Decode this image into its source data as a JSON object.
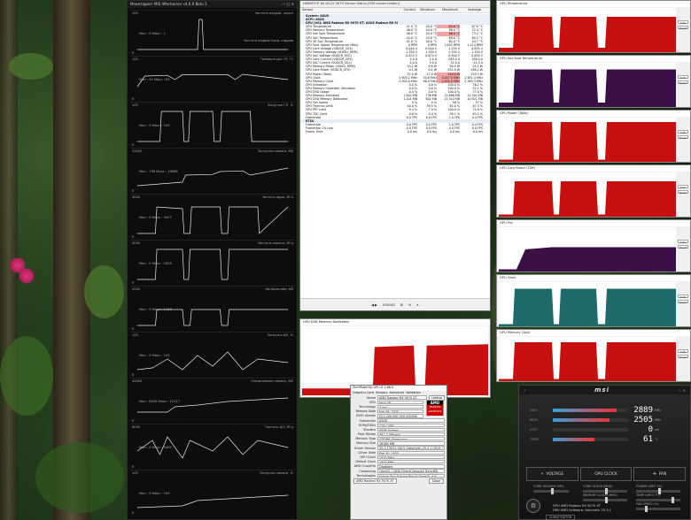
{
  "afterburner": {
    "title": "Мониторинг MSI Afterburner v4.6.6 Beta 5",
    "panels": [
      {
        "top": "Частота кадров, средн",
        "right": "Частота кадров Сред. кадров",
        "max": "100",
        "min": "0",
        "left": "Мин : 0   Макс : 1"
      },
      {
        "top": "Температура ГП, °С",
        "max": "100",
        "min": "0",
        "left": "Мин : 41   Макс : 83"
      },
      {
        "top": "Загрузка ГП, %",
        "max": "100",
        "min": "0",
        "left": "Мин : 0   Макс : 100"
      },
      {
        "top": "Загрузка памяти, МБ",
        "max": "32000",
        "min": "0",
        "left": "Мин : 736   Макс : 15866"
      },
      {
        "top": "Частота ядра, МГц",
        "max": "3000",
        "min": "0",
        "left": "Мин : 0   Макс : 3007"
      },
      {
        "top": "Частота памяти, МГц",
        "max": "3000",
        "min": "0",
        "left": "Мин : 0   Макс : 2505"
      },
      {
        "top": "Напряжение, мВ",
        "max": "2000",
        "min": "0",
        "left": "Мин : 0   Макс : 1155"
      },
      {
        "top": "Загрузка ЦП, %",
        "max": "100",
        "min": "0",
        "left": "Мин : 0   Макс : 100"
      },
      {
        "top": "Оперативная память, МБ",
        "max": "32000",
        "min": "0",
        "left": "Мин : 8416   Макс : 15117"
      },
      {
        "top": "Частота ЦП, МГц",
        "max": "6000",
        "min": "0",
        "left": "Мин : 0   Макс : 5400"
      },
      {
        "top": "Загрузка памяти, %",
        "max": "100",
        "min": "0",
        "left": "Мин : 0   Макс : 100"
      }
    ]
  },
  "hwinfo": {
    "title": "HWiNFO® 64 v8.22-5670 Sensor Status [556 values hidden]",
    "columns": [
      "Sensor",
      "Current",
      "Minimum",
      "Maximum",
      "Average"
    ],
    "rows": [
      {
        "s": 1,
        "n": "System: ASUS"
      },
      {
        "s": 1,
        "n": "ACPI: ASUS"
      },
      {
        "s": 1,
        "n": "GPU [#0]: AMD Radeon RX 9070 XT: ASUS Radeon RX 9070 XT"
      },
      {
        "n": "GPU Temperature",
        "c": "41.0 °C",
        "mi": "40.0 °C",
        "ma": "83.0 °C",
        "a": "67.0 °C",
        "h": 1
      },
      {
        "n": "GPU Memory Temperature",
        "c": "46.0 °C",
        "mi": "44.0 °C",
        "ma": "88.0 °C",
        "a": "72.4 °C"
      },
      {
        "n": "GPU Hot Spot Temperature",
        "c": "46.0 °C",
        "mi": "45.0 °C",
        "ma": "88.0 °C",
        "a": "73.2 °C",
        "h": 1
      },
      {
        "n": "GPU SoC Temperature",
        "c": "44.0 °C",
        "mi": "43.0 °C",
        "ma": "69.0 °C",
        "a": "60.2 °C"
      },
      {
        "n": "GPU VR SoC Temperature",
        "c": "41.0 °C",
        "mi": "40.0 °C",
        "ma": "62.0 °C",
        "a": "54.7 °C"
      },
      {
        "n": "GPU Fan1 Speed Temperature (Max)",
        "c": "0 RPM",
        "mi": "0 RPM",
        "ma": "1,852 RPM",
        "a": "1,214 RPM"
      },
      {
        "n": "GPU Core Voltage (VDDCR_GFX)",
        "c": "0.040 V",
        "mi": "0.040 V",
        "ma": "1.155 V",
        "a": "0.835 V"
      },
      {
        "n": "GPU Memory Voltage (VDDIO_MEM)",
        "c": "1.350 V",
        "mi": "1.350 V",
        "ma": "1.350 V",
        "a": "1.350 V"
      },
      {
        "n": "GPU SoC Voltage (VDDCR_SOC)",
        "c": "0.674 V",
        "mi": "0.674 V",
        "ma": "0.900 V",
        "a": "0.850 V"
      },
      {
        "n": "GPU Core Current (VDDCR_GFX)",
        "c": "2.0 A",
        "mi": "1.0 A",
        "ma": "283.0 A",
        "a": "198.4 A"
      },
      {
        "n": "GPU SoC Current (VDDCR_SOC)",
        "c": "4.0 A",
        "mi": "3.0 A",
        "ma": "31.0 A",
        "a": "24.3 A"
      },
      {
        "n": "GPU Memory Power (VDDCI_MEM)",
        "c": "10.2 W",
        "mi": "9.8 W",
        "ma": "30.4 W",
        "a": "25.1 W"
      },
      {
        "n": "GPU Core Power (VDDCR_GFX)",
        "c": "0.1 W",
        "mi": "0.1 W",
        "ma": "291.0 W",
        "a": "198.2 W"
      },
      {
        "n": "GPU Power (Total)",
        "c": "32.0 W",
        "mi": "27.0 W",
        "ma": "340.0 W",
        "a": "259.3 W",
        "h": 1
      },
      {
        "n": "GPU Clock",
        "c": "2,903.2 MHz",
        "mi": "30.6 MHz",
        "ma": "3,007.0 MHz",
        "a": "2,651.4 MHz",
        "h": 1
      },
      {
        "n": "GPU Memory Clock",
        "c": "2,505.0 MHz",
        "mi": "96.0 MHz",
        "ma": "2,505.0 MHz",
        "a": "2,389.3 MHz",
        "h": 1
      },
      {
        "n": "GPU Utilization",
        "c": "0.0 %",
        "mi": "0.0 %",
        "ma": "100.0 %",
        "a": "76.2 %"
      },
      {
        "n": "GPU Memory Controller Utilization",
        "c": "0.0 %",
        "mi": "0.0 %",
        "ma": "100.0 %",
        "a": "52.1 %"
      },
      {
        "n": "GPU D3D Usage",
        "c": "0.4 %",
        "mi": "0.0 %",
        "ma": "100.0 %",
        "a": "77.0 %"
      },
      {
        "n": "GPU Memory Allocated",
        "c": "1,842 MB",
        "mi": "736 MB",
        "ma": "15,866 MB",
        "a": "11,302 MB"
      },
      {
        "n": "GPU D3D Memory Dedicated",
        "c": "1,401 MB",
        "mi": "602 MB",
        "ma": "15,310 MB",
        "a": "10,921 MB"
      },
      {
        "n": "GPU Fan Speed",
        "c": "0 %",
        "mi": "0 %",
        "ma": "56 %",
        "a": "37 %"
      },
      {
        "n": "GPU Thermal Limit",
        "c": "40.0 %",
        "mi": "39.5 %",
        "ma": "82.0 %",
        "a": "67.3 %"
      },
      {
        "n": "GPU PPT Limit",
        "c": "9.3 %",
        "mi": "7.9 %",
        "ma": "100.0 %",
        "a": "75.8 %"
      },
      {
        "n": "GPU TDC Limit",
        "c": "0.8 %",
        "mi": "0.4 %",
        "ma": "90.1 %",
        "a": "63.2 %"
      },
      {
        "n": "Framerate",
        "c": "0.0 FPS",
        "mi": "0.0 FPS",
        "ma": "1.0 FPS",
        "a": "0.4 FPS"
      },
      {
        "s": 1,
        "n": "RTSS"
      },
      {
        "n": "Framerate",
        "c": "0.0 FPS",
        "mi": "0.0 FPS",
        "ma": "1.0 FPS",
        "a": "0.4 FPS"
      },
      {
        "n": "Framerate 1% Low",
        "c": "0.0 FPS",
        "mi": "0.0 FPS",
        "ma": "0.0 FPS",
        "a": "0.0 FPS"
      },
      {
        "n": "Frame Time",
        "c": "0.0 ms",
        "mi": "0.0 ms",
        "ma": "0.0 ms",
        "a": "0.0 ms"
      }
    ],
    "status_time": "0:50:00"
  },
  "memwin": {
    "title": "GPU D3D Memory Dedicated"
  },
  "gpuz": {
    "title": "TechPowerUp GPU-Z 2.66.0",
    "tabs": [
      "Graphics Card",
      "Sensors",
      "Advanced",
      "Validation"
    ],
    "lookup": "Lookup",
    "fields": [
      [
        "Name",
        "AMD Radeon RX 9070 XT"
      ],
      [
        "GPU",
        "Navi 48"
      ],
      [
        "Technology",
        "4 nm"
      ],
      [
        "Release Date",
        "Feb 28, 2025"
      ],
      [
        "BIOS Version",
        "022.000.000.000.000000"
      ],
      [
        "Subvendor",
        "ASUS"
      ],
      [
        "ROPs/TMUs",
        "128 / 256"
      ],
      [
        "Shaders",
        "4096 Unified"
      ],
      [
        "Pixel Fillrate",
        "381.7 GPixel/s"
      ],
      [
        "Memory Type",
        "GDDR6 (Samsung)"
      ],
      [
        "Memory Size",
        "16384 MB"
      ],
      [
        "Driver Version",
        "32.0.13031.3015 (Adrenalin 25.3.1) DCH / Win11 64"
      ],
      [
        "Driver Date",
        "Feb 20, 2025"
      ],
      [
        "GPU Clock",
        "2400 MHz"
      ],
      [
        "Default Clock",
        "2400 MHz"
      ],
      [
        "AMD CrossFire",
        "Disabled"
      ],
      [
        "Computing",
        "OpenCL  CUDA  DirectCompute  DirectML"
      ],
      [
        "Technologies",
        "Vulkan  Ray Tracing  PhysX  OpenGL 4.6"
      ]
    ],
    "footer": "AMD Radeon RX 9070 XT",
    "close": "Close"
  },
  "right_graphs": [
    {
      "title": "GPU Temperature"
    },
    {
      "title": "GPU Hot Spot Temperature"
    },
    {
      "title": "GPU Power (Total)"
    },
    {
      "title": "GPU Core Power (TDP)"
    },
    {
      "title": "GPU Fan"
    },
    {
      "title": "GPU Clock"
    },
    {
      "title": "GPU Memory Clock"
    }
  ],
  "right_side": [
    "Auto Fit",
    "Reset"
  ],
  "msi": {
    "logo": "msi",
    "rows": [
      {
        "label": "GPU",
        "value": "2889",
        "unit": "MHz",
        "fill": 0.85
      },
      {
        "label": "MEM",
        "value": "2505",
        "unit": "MHz",
        "fill": 0.75
      },
      {
        "label": "VOLT",
        "value": "0",
        "unit": "mV",
        "fill": 0.0
      },
      {
        "label": "TEMP",
        "value": "61",
        "unit": "°C",
        "fill": 0.55
      }
    ],
    "buttons": [
      "VOLTAGE",
      "GPU CLOCK",
      "FAN"
    ],
    "sliders": [
      "CORE VOLTAGE (MV)",
      "CORE CLOCK (MHZ)",
      "POWER LIMIT (%)",
      "MEMORY CLOCK (MHZ)",
      "TEMP LIMIT (°C)",
      "FAN SPEED (%)"
    ],
    "info": [
      "GPU  AMD Radeon RX 9070 XT",
      "DRV  AMD Software: Adrenalin 25.3.1"
    ],
    "kombustor": "KOMBUSTOR",
    "curve": "CURVE EDITOR"
  },
  "colors": {
    "red": "#c80f0f",
    "purple": "#3a1046",
    "teal": "#1e6a6a",
    "msi_bg": "#1a1a1a"
  }
}
